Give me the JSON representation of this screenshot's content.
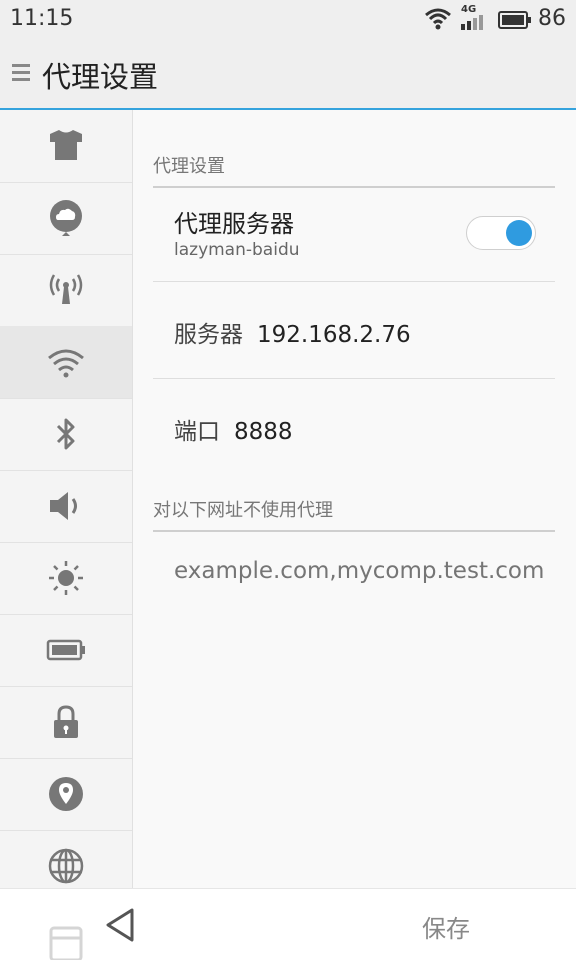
{
  "status_bar": {
    "time": "11:15",
    "network_label": "4G",
    "battery_percent": "86",
    "icons": [
      "wifi-icon",
      "signal-icon",
      "battery-icon"
    ]
  },
  "action_bar": {
    "title": "代理设置",
    "menu_icon": "menu-icon"
  },
  "sidebar": {
    "items": [
      {
        "icon": "theme-shirt-icon"
      },
      {
        "icon": "cloud-icon"
      },
      {
        "icon": "hotspot-icon"
      },
      {
        "icon": "wifi-icon",
        "active": true
      },
      {
        "icon": "bluetooth-icon"
      },
      {
        "icon": "volume-icon"
      },
      {
        "icon": "brightness-icon"
      },
      {
        "icon": "battery-icon"
      },
      {
        "icon": "lock-icon"
      },
      {
        "icon": "location-icon"
      },
      {
        "icon": "globe-icon"
      }
    ]
  },
  "proxy": {
    "section_header": "代理设置",
    "server_title": "代理服务器",
    "server_subtitle": "lazyman-baidu",
    "enabled": true,
    "host_label": "服务器",
    "host_value": "192.168.2.76",
    "port_label": "端口",
    "port_value": "8888",
    "bypass_header": "对以下网址不使用代理",
    "bypass_placeholder": "example.com,mycomp.test.com"
  },
  "bottom_bar": {
    "save_label": "保存",
    "back_icon": "back-icon"
  },
  "colors": {
    "accent": "#2f9be0",
    "actionbar_bg": "#efefef",
    "sidebar_bg": "#f4f4f4"
  }
}
